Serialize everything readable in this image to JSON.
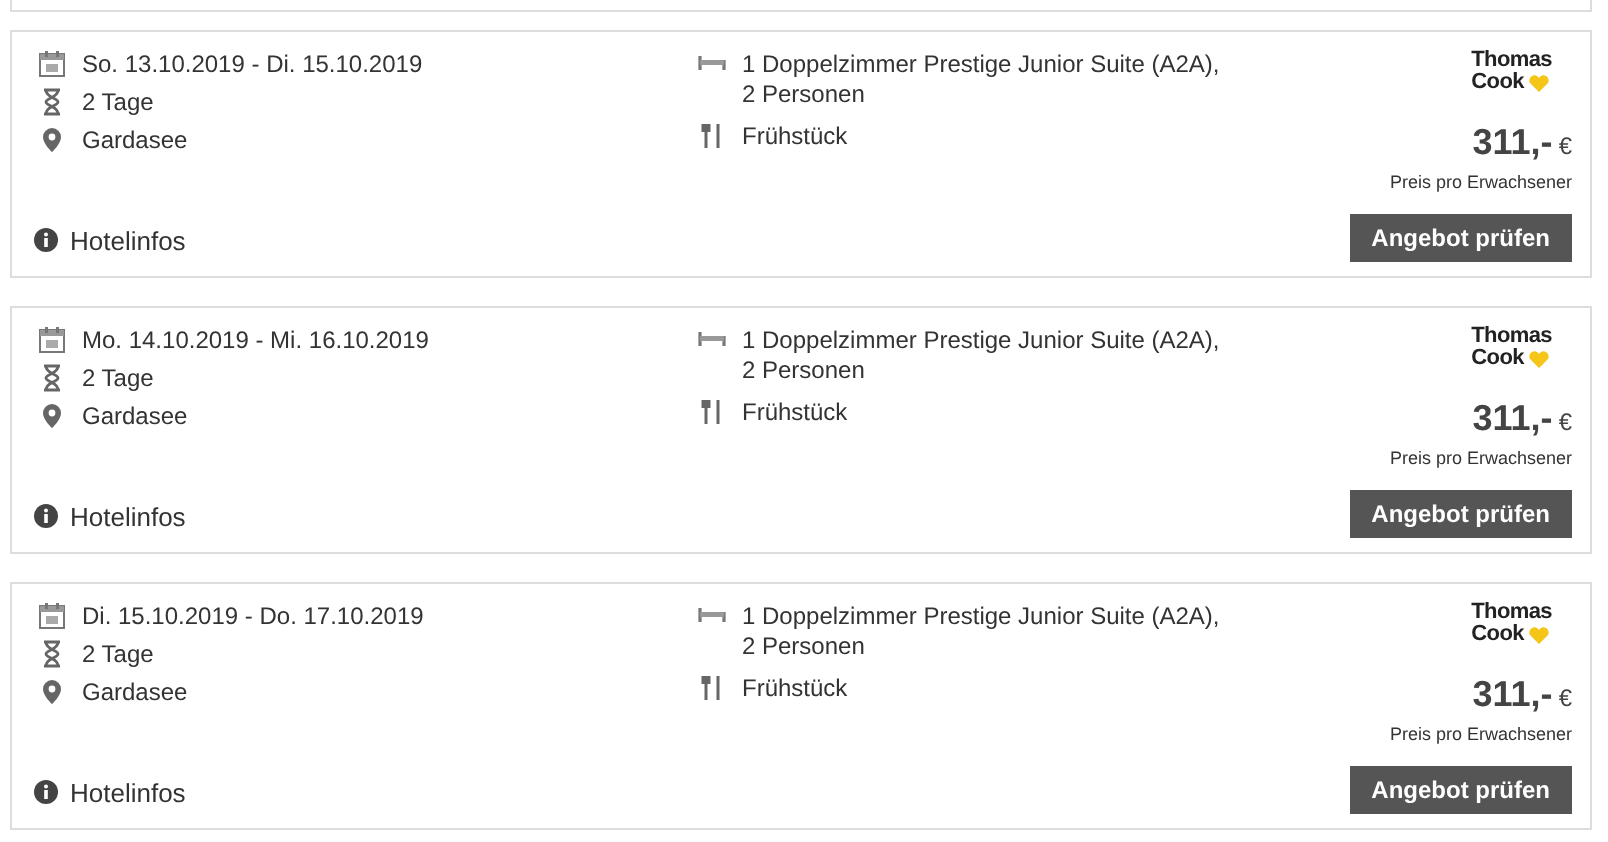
{
  "offers": [
    {
      "dates": "So. 13.10.2019 - Di. 15.10.2019",
      "duration": "2 Tage",
      "location": "Gardasee",
      "room": "1 Doppelzimmer Prestige Junior Suite (A2A),",
      "persons": "2 Personen",
      "board": "Frühstück",
      "operator": [
        "Thomas",
        "Cook"
      ],
      "price": "311,-",
      "currency": "€",
      "price_note": "Preis pro Erwachsener",
      "button": "Angebot prüfen",
      "info": "Hotelinfos"
    },
    {
      "dates": "Mo. 14.10.2019 - Mi. 16.10.2019",
      "duration": "2 Tage",
      "location": "Gardasee",
      "room": "1 Doppelzimmer Prestige Junior Suite (A2A),",
      "persons": "2 Personen",
      "board": "Frühstück",
      "operator": [
        "Thomas",
        "Cook"
      ],
      "price": "311,-",
      "currency": "€",
      "price_note": "Preis pro Erwachsener",
      "button": "Angebot prüfen",
      "info": "Hotelinfos"
    },
    {
      "dates": "Di. 15.10.2019 - Do. 17.10.2019",
      "duration": "2 Tage",
      "location": "Gardasee",
      "room": "1 Doppelzimmer Prestige Junior Suite (A2A),",
      "persons": "2 Personen",
      "board": "Frühstück",
      "operator": [
        "Thomas",
        "Cook"
      ],
      "price": "311,-",
      "currency": "€",
      "price_note": "Preis pro Erwachsener",
      "button": "Angebot prüfen",
      "info": "Hotelinfos"
    }
  ]
}
